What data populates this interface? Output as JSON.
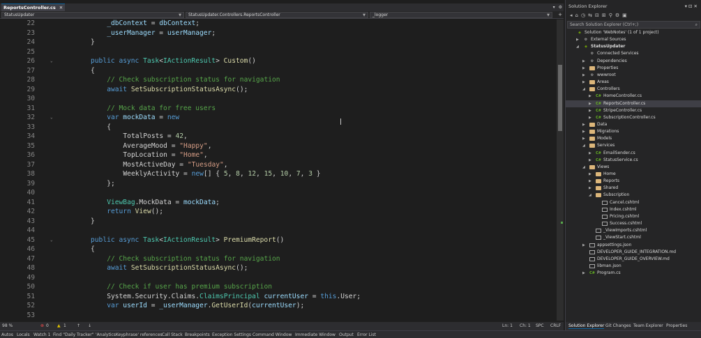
{
  "editor": {
    "tab_label": "ReportsController.cs",
    "tab_close": "✕",
    "nav": {
      "project": "StatusUpdater",
      "type": "StatusUpdater.Controllers.ReportsController",
      "member": "_logger"
    },
    "lines": [
      {
        "n": "22",
        "indent": 2,
        "tokens": [
          [
            "va",
            "_dbContext"
          ],
          [
            "pl",
            " = "
          ],
          [
            "va",
            "dbContext"
          ],
          [
            "pl",
            ";"
          ]
        ]
      },
      {
        "n": "23",
        "indent": 2,
        "tokens": [
          [
            "va",
            "_userManager"
          ],
          [
            "pl",
            " = "
          ],
          [
            "va",
            "userManager"
          ],
          [
            "pl",
            ";"
          ]
        ]
      },
      {
        "n": "24",
        "indent": 1,
        "tokens": [
          [
            "pl",
            "}"
          ]
        ]
      },
      {
        "n": "25",
        "indent": 0,
        "tokens": []
      },
      {
        "n": "26",
        "indent": 1,
        "fold": true,
        "tokens": [
          [
            "kw",
            "public"
          ],
          [
            "pl",
            " "
          ],
          [
            "kw",
            "async"
          ],
          [
            "pl",
            " "
          ],
          [
            "ty",
            "Task"
          ],
          [
            "pl",
            "<"
          ],
          [
            "ty",
            "IActionResult"
          ],
          [
            "pl",
            "> "
          ],
          [
            "fn",
            "Custom"
          ],
          [
            "pl",
            "()"
          ]
        ]
      },
      {
        "n": "27",
        "indent": 1,
        "tokens": [
          [
            "pl",
            "{"
          ]
        ]
      },
      {
        "n": "28",
        "indent": 2,
        "tokens": [
          [
            "cm",
            "// Check subscription status for navigation"
          ]
        ]
      },
      {
        "n": "29",
        "indent": 2,
        "tokens": [
          [
            "kw",
            "await"
          ],
          [
            "pl",
            " "
          ],
          [
            "fn",
            "SetSubscriptionStatusAsync"
          ],
          [
            "pl",
            "();"
          ]
        ]
      },
      {
        "n": "30",
        "indent": 0,
        "tokens": []
      },
      {
        "n": "31",
        "indent": 2,
        "tokens": [
          [
            "cm",
            "// Mock data for free users"
          ]
        ]
      },
      {
        "n": "32",
        "indent": 2,
        "fold": true,
        "tokens": [
          [
            "kw",
            "var"
          ],
          [
            "pl",
            " "
          ],
          [
            "va",
            "mockData"
          ],
          [
            "pl",
            " = "
          ],
          [
            "kw",
            "new"
          ]
        ]
      },
      {
        "n": "33",
        "indent": 2,
        "tokens": [
          [
            "pl",
            "{"
          ]
        ]
      },
      {
        "n": "34",
        "indent": 3,
        "tokens": [
          [
            "pl",
            "TotalPosts = "
          ],
          [
            "nu",
            "42"
          ],
          [
            "pl",
            ","
          ]
        ]
      },
      {
        "n": "35",
        "indent": 3,
        "tokens": [
          [
            "pl",
            "AverageMood = "
          ],
          [
            "st",
            "\"Happy\""
          ],
          [
            "pl",
            ","
          ]
        ]
      },
      {
        "n": "36",
        "indent": 3,
        "tokens": [
          [
            "pl",
            "TopLocation = "
          ],
          [
            "st",
            "\"Home\""
          ],
          [
            "pl",
            ","
          ]
        ]
      },
      {
        "n": "37",
        "indent": 3,
        "tokens": [
          [
            "pl",
            "MostActiveDay = "
          ],
          [
            "st",
            "\"Tuesday\""
          ],
          [
            "pl",
            ","
          ]
        ]
      },
      {
        "n": "38",
        "indent": 3,
        "tokens": [
          [
            "pl",
            "WeeklyActivity = "
          ],
          [
            "kw",
            "new"
          ],
          [
            "pl",
            "[] { "
          ],
          [
            "nu",
            "5"
          ],
          [
            "pl",
            ", "
          ],
          [
            "nu",
            "8"
          ],
          [
            "pl",
            ", "
          ],
          [
            "nu",
            "12"
          ],
          [
            "pl",
            ", "
          ],
          [
            "nu",
            "15"
          ],
          [
            "pl",
            ", "
          ],
          [
            "nu",
            "10"
          ],
          [
            "pl",
            ", "
          ],
          [
            "nu",
            "7"
          ],
          [
            "pl",
            ", "
          ],
          [
            "nu",
            "3"
          ],
          [
            "pl",
            " }"
          ]
        ]
      },
      {
        "n": "39",
        "indent": 2,
        "tokens": [
          [
            "pl",
            "};"
          ]
        ]
      },
      {
        "n": "40",
        "indent": 0,
        "tokens": []
      },
      {
        "n": "41",
        "indent": 2,
        "tokens": [
          [
            "ty",
            "ViewBag"
          ],
          [
            "pl",
            ".MockData = "
          ],
          [
            "va",
            "mockData"
          ],
          [
            "pl",
            ";"
          ]
        ]
      },
      {
        "n": "42",
        "indent": 2,
        "tokens": [
          [
            "kw",
            "return"
          ],
          [
            "pl",
            " "
          ],
          [
            "fn",
            "View"
          ],
          [
            "pl",
            "();"
          ]
        ]
      },
      {
        "n": "43",
        "indent": 1,
        "tokens": [
          [
            "pl",
            "}"
          ]
        ]
      },
      {
        "n": "44",
        "indent": 0,
        "tokens": []
      },
      {
        "n": "45",
        "indent": 1,
        "fold": true,
        "tokens": [
          [
            "kw",
            "public"
          ],
          [
            "pl",
            " "
          ],
          [
            "kw",
            "async"
          ],
          [
            "pl",
            " "
          ],
          [
            "ty",
            "Task"
          ],
          [
            "pl",
            "<"
          ],
          [
            "ty",
            "IActionResult"
          ],
          [
            "pl",
            "> "
          ],
          [
            "fn",
            "PremiumReport"
          ],
          [
            "pl",
            "()"
          ]
        ]
      },
      {
        "n": "46",
        "indent": 1,
        "tokens": [
          [
            "pl",
            "{"
          ]
        ]
      },
      {
        "n": "47",
        "indent": 2,
        "tokens": [
          [
            "cm",
            "// Check subscription status for navigation"
          ]
        ]
      },
      {
        "n": "48",
        "indent": 2,
        "tokens": [
          [
            "kw",
            "await"
          ],
          [
            "pl",
            " "
          ],
          [
            "fn",
            "SetSubscriptionStatusAsync"
          ],
          [
            "pl",
            "();"
          ]
        ]
      },
      {
        "n": "49",
        "indent": 0,
        "tokens": []
      },
      {
        "n": "50",
        "indent": 2,
        "tokens": [
          [
            "cm",
            "// Check if user has premium subscription"
          ]
        ]
      },
      {
        "n": "51",
        "indent": 2,
        "tokens": [
          [
            "pl",
            "System.Security.Claims."
          ],
          [
            "ty",
            "ClaimsPrincipal"
          ],
          [
            "pl",
            " "
          ],
          [
            "va",
            "currentUser"
          ],
          [
            "pl",
            " = "
          ],
          [
            "kw",
            "this"
          ],
          [
            "pl",
            ".User;"
          ]
        ]
      },
      {
        "n": "52",
        "indent": 2,
        "tokens": [
          [
            "kw",
            "var"
          ],
          [
            "pl",
            " "
          ],
          [
            "va",
            "userId"
          ],
          [
            "pl",
            " = "
          ],
          [
            "va",
            "_userManager"
          ],
          [
            "pl",
            "."
          ],
          [
            "fn",
            "GetUserId"
          ],
          [
            "pl",
            "("
          ],
          [
            "va",
            "currentUser"
          ],
          [
            "pl",
            ");"
          ]
        ]
      },
      {
        "n": "53",
        "indent": 0,
        "tokens": []
      }
    ],
    "status": {
      "zoom": "98 %",
      "errors": "0",
      "warnings": "1",
      "line": "Ln: 1",
      "col": "Ch: 1",
      "spc": "SPC",
      "crlf": "CRLF"
    }
  },
  "solution_explorer": {
    "title": "Solution Explorer",
    "title_icons": "▾ ⊡ ✕",
    "search_placeholder": "Search Solution Explorer (Ctrl+;)",
    "items": [
      {
        "label": "Solution 'WebNotes' (1 of 1 project)",
        "depth": 0,
        "arrow": "",
        "icon": "proj"
      },
      {
        "label": "External Sources",
        "depth": 1,
        "arrow": "▶",
        "icon": "gear"
      },
      {
        "label": "StatusUpdater",
        "depth": 1,
        "arrow": "◢",
        "icon": "proj",
        "bold": true
      },
      {
        "label": "Connected Services",
        "depth": 2,
        "arrow": "",
        "icon": "gear"
      },
      {
        "label": "Dependencies",
        "depth": 2,
        "arrow": "▶",
        "icon": "gear"
      },
      {
        "label": "Properties",
        "depth": 2,
        "arrow": "▶",
        "icon": "folder"
      },
      {
        "label": "wwwroot",
        "depth": 2,
        "arrow": "▶",
        "icon": "gear"
      },
      {
        "label": "Areas",
        "depth": 2,
        "arrow": "▶",
        "icon": "folder"
      },
      {
        "label": "Controllers",
        "depth": 2,
        "arrow": "◢",
        "icon": "folder"
      },
      {
        "label": "HomeController.cs",
        "depth": 3,
        "arrow": "▶",
        "icon": "cs"
      },
      {
        "label": "ReportsController.cs",
        "depth": 3,
        "arrow": "▶",
        "icon": "cs",
        "selected": true
      },
      {
        "label": "StripeController.cs",
        "depth": 3,
        "arrow": "▶",
        "icon": "cs"
      },
      {
        "label": "SubscriptionController.cs",
        "depth": 3,
        "arrow": "▶",
        "icon": "cs"
      },
      {
        "label": "Data",
        "depth": 2,
        "arrow": "▶",
        "icon": "folder"
      },
      {
        "label": "Migrations",
        "depth": 2,
        "arrow": "▶",
        "icon": "folder"
      },
      {
        "label": "Models",
        "depth": 2,
        "arrow": "▶",
        "icon": "folder"
      },
      {
        "label": "Services",
        "depth": 2,
        "arrow": "◢",
        "icon": "folder"
      },
      {
        "label": "EmailSender.cs",
        "depth": 3,
        "arrow": "▶",
        "icon": "cs"
      },
      {
        "label": "StatusService.cs",
        "depth": 3,
        "arrow": "▶",
        "icon": "cs"
      },
      {
        "label": "Views",
        "depth": 2,
        "arrow": "◢",
        "icon": "folder"
      },
      {
        "label": "Home",
        "depth": 3,
        "arrow": "▶",
        "icon": "folder"
      },
      {
        "label": "Reports",
        "depth": 3,
        "arrow": "▶",
        "icon": "folder"
      },
      {
        "label": "Shared",
        "depth": 3,
        "arrow": "▶",
        "icon": "folder"
      },
      {
        "label": "Subscription",
        "depth": 3,
        "arrow": "◢",
        "icon": "folder"
      },
      {
        "label": "Cancel.cshtml",
        "depth": 4,
        "arrow": "",
        "icon": "file"
      },
      {
        "label": "Index.cshtml",
        "depth": 4,
        "arrow": "",
        "icon": "file"
      },
      {
        "label": "Pricing.cshtml",
        "depth": 4,
        "arrow": "",
        "icon": "file"
      },
      {
        "label": "Success.cshtml",
        "depth": 4,
        "arrow": "",
        "icon": "file"
      },
      {
        "label": "_ViewImports.cshtml",
        "depth": 3,
        "arrow": "",
        "icon": "file"
      },
      {
        "label": "_ViewStart.cshtml",
        "depth": 3,
        "arrow": "",
        "icon": "file"
      },
      {
        "label": "appsettings.json",
        "depth": 2,
        "arrow": "▶",
        "icon": "file"
      },
      {
        "label": "DEVELOPER_GUIDE_INTEGRATION.md",
        "depth": 2,
        "arrow": "",
        "icon": "file"
      },
      {
        "label": "DEVELOPER_GUIDE_OVERVIEW.md",
        "depth": 2,
        "arrow": "",
        "icon": "file"
      },
      {
        "label": "libman.json",
        "depth": 2,
        "arrow": "",
        "icon": "file"
      },
      {
        "label": "Program.cs",
        "depth": 2,
        "arrow": "▶",
        "icon": "cs"
      }
    ],
    "tabs": [
      "Solution Explorer",
      "Git Changes",
      "Team Explorer",
      "Properties"
    ]
  },
  "bottom_tabs": [
    "Autos",
    "Locals",
    "Watch 1",
    "Find \"Daily Tracker\"",
    "'AnalyticsKeyphrase' references",
    "Call Stack",
    "Breakpoints",
    "Exception Settings",
    "Command Window",
    "Immediate Window",
    "Output",
    "Error List"
  ],
  "colors": {
    "accent": "#0e639c",
    "comment": "#57a64a",
    "keyword": "#569cd6",
    "type": "#4ec9b0",
    "string": "#d69d85"
  }
}
